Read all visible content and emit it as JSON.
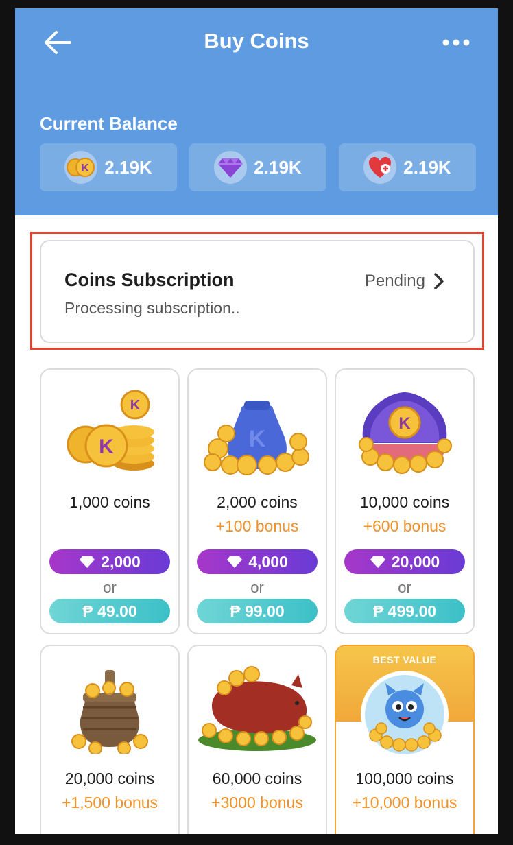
{
  "header": {
    "title": "Buy Coins",
    "balance_label": "Current Balance",
    "balances": [
      {
        "icon": "k-coin-icon",
        "value": "2.19K"
      },
      {
        "icon": "diamond-icon",
        "value": "2.19K"
      },
      {
        "icon": "health-heart-icon",
        "value": "2.19K"
      }
    ]
  },
  "subscription": {
    "title": "Coins Subscription",
    "status": "Pending",
    "description": "Processing subscription.."
  },
  "packages": [
    {
      "coins": "1,000 coins",
      "bonus": "",
      "gems": "2,000",
      "or": "or",
      "price": "₱ 49.00"
    },
    {
      "coins": "2,000 coins",
      "bonus": "+100 bonus",
      "gems": "4,000",
      "or": "or",
      "price": "₱ 99.00"
    },
    {
      "coins": "10,000 coins",
      "bonus": "+600 bonus",
      "gems": "20,000",
      "or": "or",
      "price": "₱ 499.00"
    },
    {
      "coins": "20,000 coins",
      "bonus": "+1,500 bonus"
    },
    {
      "coins": "60,000 coins",
      "bonus": "+3000 bonus"
    },
    {
      "coins": "100,000 coins",
      "bonus": "+10,000 bonus",
      "badge": "BEST VALUE"
    }
  ],
  "colors": {
    "header_bg": "#5f9be0",
    "bonus": "#f0922a",
    "gem_button": "#8a3ad0",
    "price_button": "#4fc8cc",
    "highlight": "#e0432e"
  }
}
